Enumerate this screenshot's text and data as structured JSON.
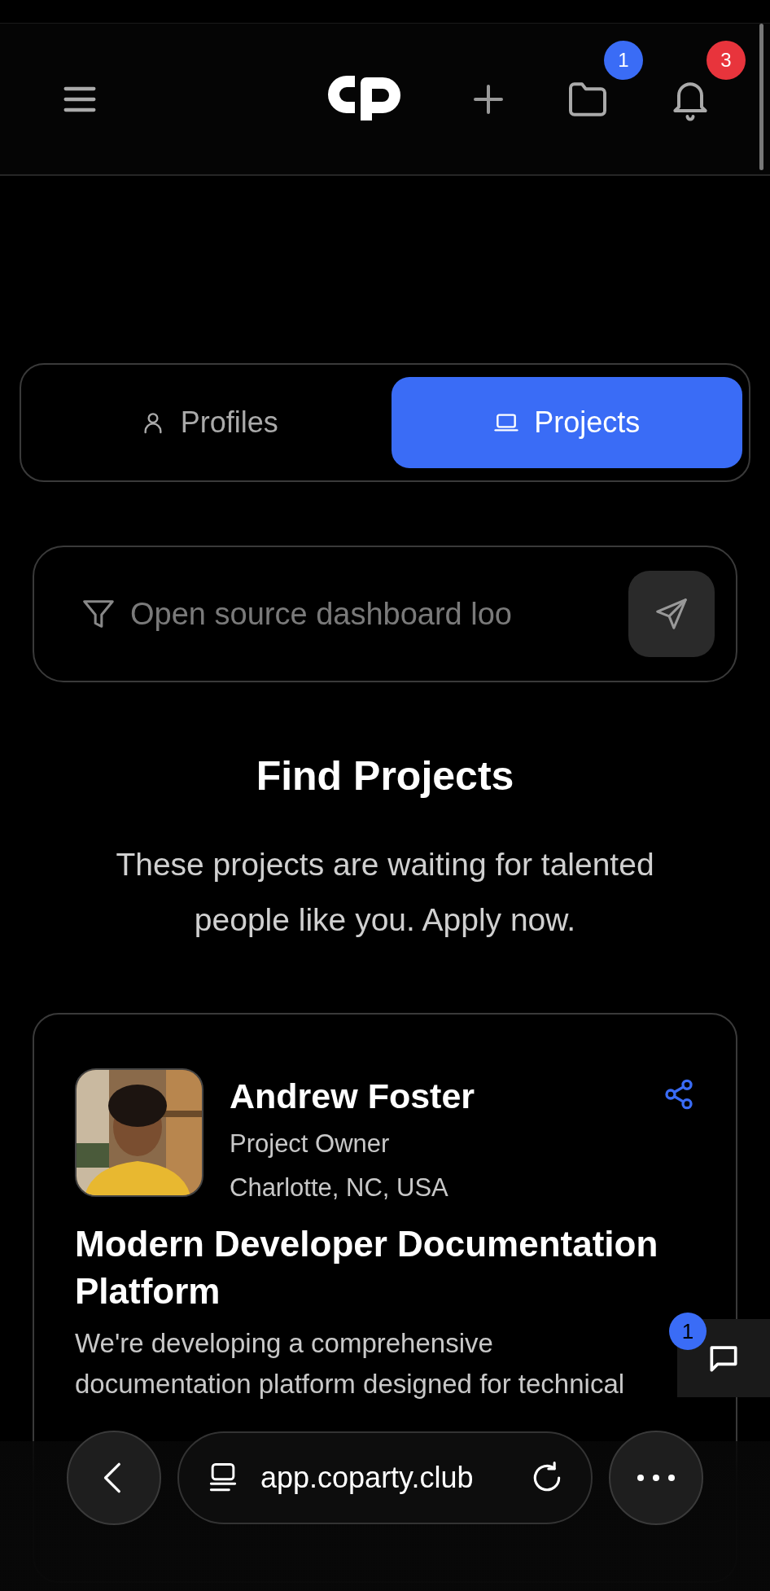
{
  "header": {
    "badges": [
      {
        "kind": "folder",
        "count": "1",
        "color": "#3a6cf6"
      },
      {
        "kind": "bell",
        "count": "3",
        "color": "#e8343c"
      }
    ]
  },
  "tabs": [
    {
      "label": "Profiles",
      "kind": "person",
      "selected": false
    },
    {
      "label": "Projects",
      "kind": "laptop",
      "selected": true
    }
  ],
  "search": {
    "placeholder": "Open source dashboard loo"
  },
  "heading": {
    "title": "Find Projects",
    "subtitle": "These projects are waiting for talented people like you. Apply now."
  },
  "project": {
    "owner": "Andrew Foster",
    "role": "Project Owner",
    "location": "Charlotte, NC, USA",
    "title": "Modern Developer Documentation Platform",
    "description": "We're developing a comprehensive documentation platform designed for technical"
  },
  "chat": {
    "count": "1"
  },
  "browser_bar": {
    "url": "app.coparty.club"
  }
}
